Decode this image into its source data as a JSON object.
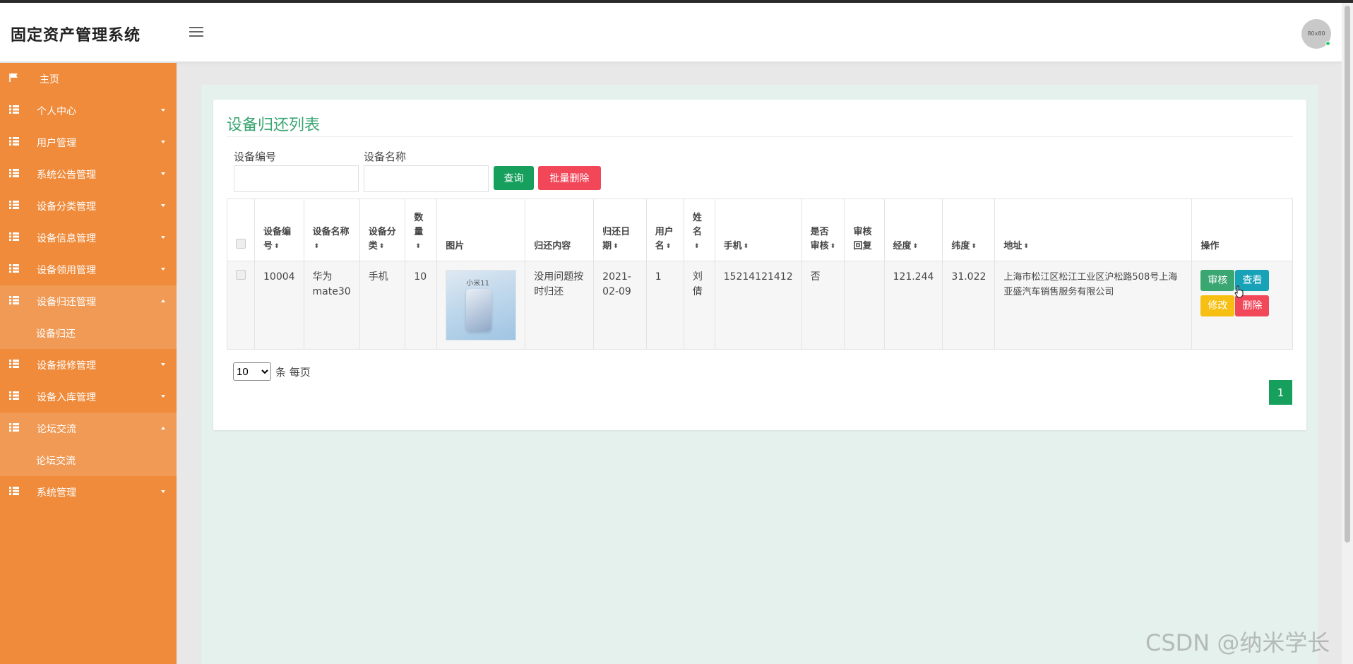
{
  "app": {
    "title": "固定资产管理系统",
    "avatar_text": "80x80"
  },
  "sidebar": {
    "items": [
      {
        "label": "主页",
        "icon": "flag-icon",
        "expanded": false
      },
      {
        "label": "个人中心",
        "icon": "grid-icon",
        "expanded": false
      },
      {
        "label": "用户管理",
        "icon": "grid-icon",
        "expanded": false
      },
      {
        "label": "系统公告管理",
        "icon": "grid-icon",
        "expanded": false
      },
      {
        "label": "设备分类管理",
        "icon": "grid-icon",
        "expanded": false
      },
      {
        "label": "设备信息管理",
        "icon": "grid-icon",
        "expanded": false
      },
      {
        "label": "设备领用管理",
        "icon": "grid-icon",
        "expanded": false
      },
      {
        "label": "设备归还管理",
        "icon": "grid-icon",
        "expanded": true,
        "sub": "设备归还"
      },
      {
        "label": "设备报修管理",
        "icon": "grid-icon",
        "expanded": false
      },
      {
        "label": "设备入库管理",
        "icon": "grid-icon",
        "expanded": false
      },
      {
        "label": "论坛交流",
        "icon": "grid-icon",
        "expanded": true,
        "sub": "论坛交流"
      },
      {
        "label": "系统管理",
        "icon": "grid-icon",
        "expanded": false
      }
    ]
  },
  "page": {
    "title": "设备归还列表",
    "search": {
      "code_label": "设备编号",
      "code_value": "",
      "name_label": "设备名称",
      "name_value": "",
      "query_button": "查询",
      "batch_delete_button": "批量删除"
    },
    "table": {
      "headers": [
        "设备编号",
        "设备名称",
        "设备分类",
        "数量",
        "图片",
        "归还内容",
        "归还日期",
        "用户名",
        "姓名",
        "手机",
        "是否审核",
        "审核回复",
        "经度",
        "纬度",
        "地址",
        "操作"
      ],
      "rows": [
        {
          "code": "10004",
          "name": "华为mate30",
          "category": "手机",
          "quantity": "10",
          "image_label": "小米11",
          "content": "没用问题按时归还",
          "date": "2021-02-09",
          "username": "1",
          "realname": "刘倩",
          "phone": "15214121412",
          "audited": "否",
          "reply": "",
          "longitude": "121.244",
          "latitude": "31.022",
          "address": "上海市松江区松江工业区沪松路508号上海亚盛汽车销售服务有限公司"
        }
      ],
      "actions": {
        "audit": "审核",
        "view": "查看",
        "edit": "修改",
        "delete": "删除"
      }
    },
    "pagination": {
      "page_size": "10",
      "page_size_suffix": "条 每页",
      "current_page": "1"
    }
  },
  "watermark": "CSDN @纳米学长",
  "colors": {
    "sidebar": "#ef8b3b",
    "title_green": "#3aa672",
    "query_green": "#17a05d",
    "danger": "#f14759",
    "info": "#17a2b8",
    "warning": "#f7bf12"
  }
}
